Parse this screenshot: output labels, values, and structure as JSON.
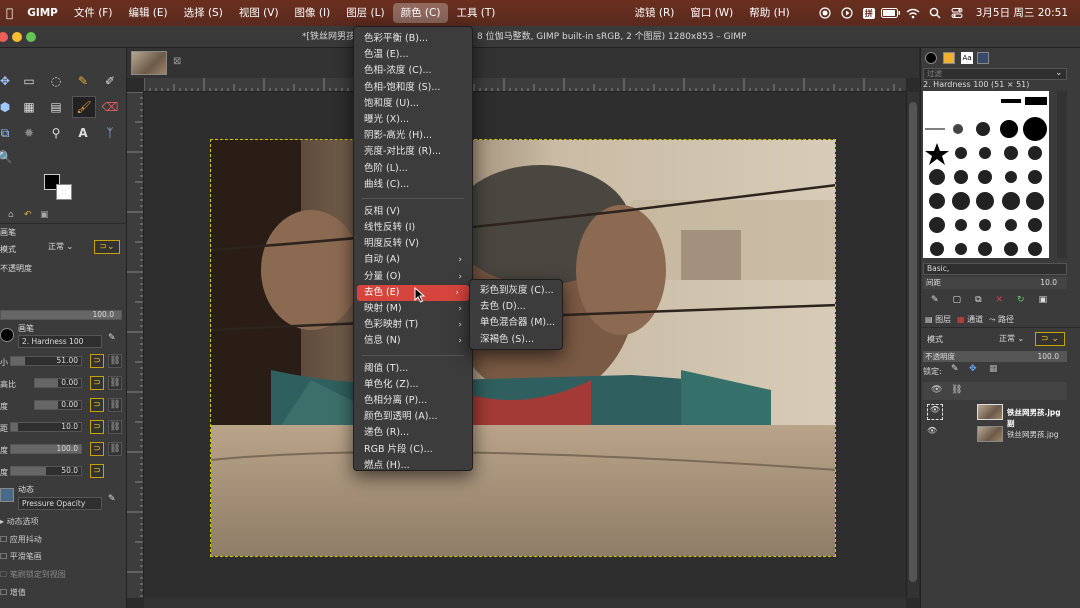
{
  "menubar": {
    "app": "GIMP",
    "items": [
      "文件 (F)",
      "编辑 (E)",
      "选择 (S)",
      "视图 (V)",
      "图像 (I)",
      "图层 (L)",
      "颜色 (C)",
      "工具 (T)"
    ],
    "right_items": [
      "滤镜 (R)",
      "窗口 (W)",
      "帮助 (H)"
    ],
    "input_method": "拼",
    "datetime": "3月5日 周三  20:51"
  },
  "window": {
    "title_left": "*[铁丝网男孩",
    "title_right": "8 位伽马整数, GIMP built-in sRGB, 2 个图层) 1280x853 – GIMP"
  },
  "menu_colors": {
    "items": [
      {
        "label": "色彩平衡 (B)..."
      },
      {
        "label": "色温 (E)..."
      },
      {
        "label": "色相-浓度 (C)..."
      },
      {
        "label": "色相-饱和度 (S)..."
      },
      {
        "label": "饱和度 (U)..."
      },
      {
        "label": "曝光 (X)..."
      },
      {
        "label": "阴影-高光 (H)..."
      },
      {
        "label": "亮度-对比度 (R)..."
      },
      {
        "label": "色阶 (L)..."
      },
      {
        "label": "曲线 (C)..."
      }
    ],
    "items2": [
      {
        "label": "反相 (V)"
      },
      {
        "label": "线性反转 (I)"
      },
      {
        "label": "明度反转 (V)"
      },
      {
        "label": "自动 (A)",
        "sub": true
      },
      {
        "label": "分量 (O)",
        "sub": true
      },
      {
        "label": "去色 (E)",
        "sub": true,
        "highlight": true
      },
      {
        "label": "映射 (M)",
        "sub": true
      },
      {
        "label": "色彩映射 (T)",
        "sub": true
      },
      {
        "label": "信息 (N)",
        "sub": true
      }
    ],
    "items3": [
      {
        "label": "阈值 (T)..."
      },
      {
        "label": "单色化 (Z)..."
      },
      {
        "label": "色相分离 (P)..."
      },
      {
        "label": "颜色到透明 (A)..."
      },
      {
        "label": "递色 (R)..."
      },
      {
        "label": "RGB 片段 (C)..."
      },
      {
        "label": "燃点 (H)..."
      }
    ]
  },
  "submenu_desaturate": {
    "items": [
      "彩色到灰度 (C)...",
      "去色 (D)...",
      "单色混合器 (M)...",
      "深褐色 (S)..."
    ]
  },
  "tool_options": {
    "brush_section": "画笔",
    "mode_label": "模式",
    "mode_value": "正常",
    "opacity_label": "不透明度",
    "opacity_value": "100.0",
    "brush_label": "画笔",
    "brush_name": "2. Hardness 100",
    "size_label": "小",
    "size_value": "51.00",
    "ratio_label": "高比",
    "ratio_value": "0.00",
    "angle_label": "度",
    "angle_value": "0.00",
    "spacing_label": "距",
    "spacing_value": "10.0",
    "hardness_label": "度",
    "hardness_value": "100.0",
    "force_label": "度",
    "force_value": "50.0",
    "dynamics_label": "动态",
    "dynamics_value": "Pressure Opacity",
    "dyn_options": "动态选项",
    "apply_jitter": "应用抖动",
    "smooth_stroke": "平滑笔画",
    "lock_brush": "笔刷锁定到视图",
    "incremental": "增值"
  },
  "right_panel": {
    "filter_placeholder": "过滤",
    "brush_title": "2. Hardness 100 (51 × 51)",
    "brush_set": "Basic,",
    "spacing_label": "间距",
    "spacing_value": "10.0",
    "tabs": [
      "图层",
      "通道",
      "路径"
    ],
    "mode_label": "模式",
    "mode_value": "正常",
    "opacity_label": "不透明度",
    "opacity_value": "100.0",
    "lock_label": "锁定:",
    "layers": [
      "铁丝网男孩.jpg 副",
      "铁丝网男孩.jpg"
    ]
  },
  "colors": {
    "menubar": "#5e2c1f",
    "highlight": "#d6453d",
    "selection": "#d6c600"
  }
}
